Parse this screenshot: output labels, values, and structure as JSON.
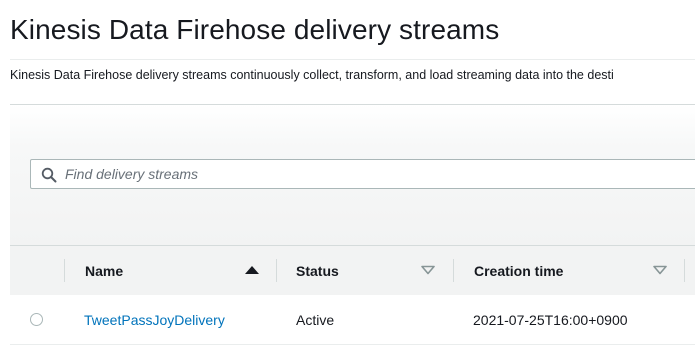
{
  "page": {
    "title": "Kinesis Data Firehose delivery streams",
    "description": "Kinesis Data Firehose delivery streams continuously collect, transform, and load streaming data into the desti"
  },
  "search": {
    "placeholder": "Find delivery streams",
    "icon": "search-icon"
  },
  "table": {
    "columns": [
      {
        "label": "Name",
        "sort": "ascending-active"
      },
      {
        "label": "Status",
        "sort": "sortable"
      },
      {
        "label": "Creation time",
        "sort": "sortable"
      }
    ],
    "rows": [
      {
        "selected": false,
        "name": "TweetPassJoyDelivery",
        "status": "Active",
        "creation_time": "2021-07-25T16:00+0900"
      }
    ]
  },
  "colors": {
    "link": "#0073bb",
    "header_bg": "#f2f3f3",
    "border": "#d5dbdb",
    "text": "#16191f"
  }
}
